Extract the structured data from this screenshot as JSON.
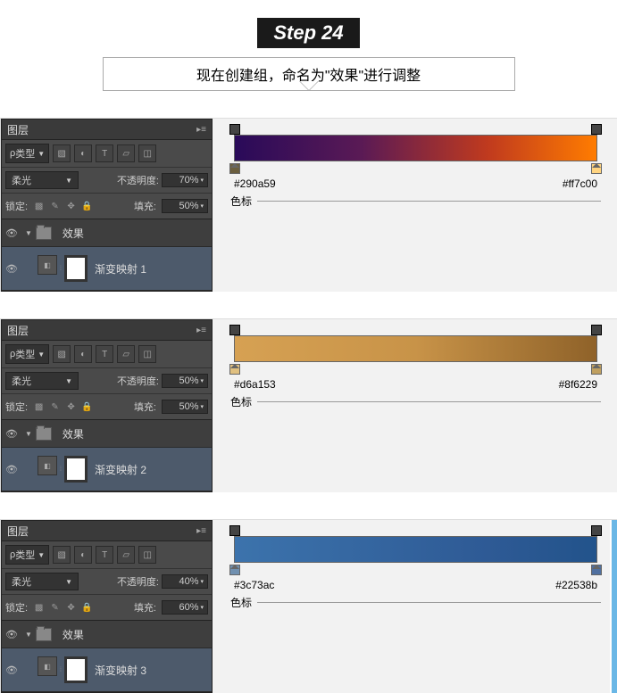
{
  "header": {
    "step": "Step 24",
    "caption": "现在创建组，命名为\"效果\"进行调整"
  },
  "panels": [
    {
      "opacity": "70%",
      "fill": "50%",
      "layerName": "渐变映射 1",
      "hexL": "#290a59",
      "hexR": "#ff7c00"
    },
    {
      "opacity": "50%",
      "fill": "50%",
      "layerName": "渐变映射 2",
      "hexL": "#d6a153",
      "hexR": "#8f6229"
    },
    {
      "opacity": "40%",
      "fill": "60%",
      "layerName": "渐变映射 3",
      "hexL": "#3c73ac",
      "hexR": "#22538b"
    }
  ],
  "labels": {
    "panelTitle": "图层",
    "kind": "类型",
    "blend": "柔光",
    "opacityLabel": "不透明度:",
    "lockLabel": "锁定:",
    "fillLabel": "填充:",
    "groupName": "效果",
    "sebiao": "色标"
  }
}
